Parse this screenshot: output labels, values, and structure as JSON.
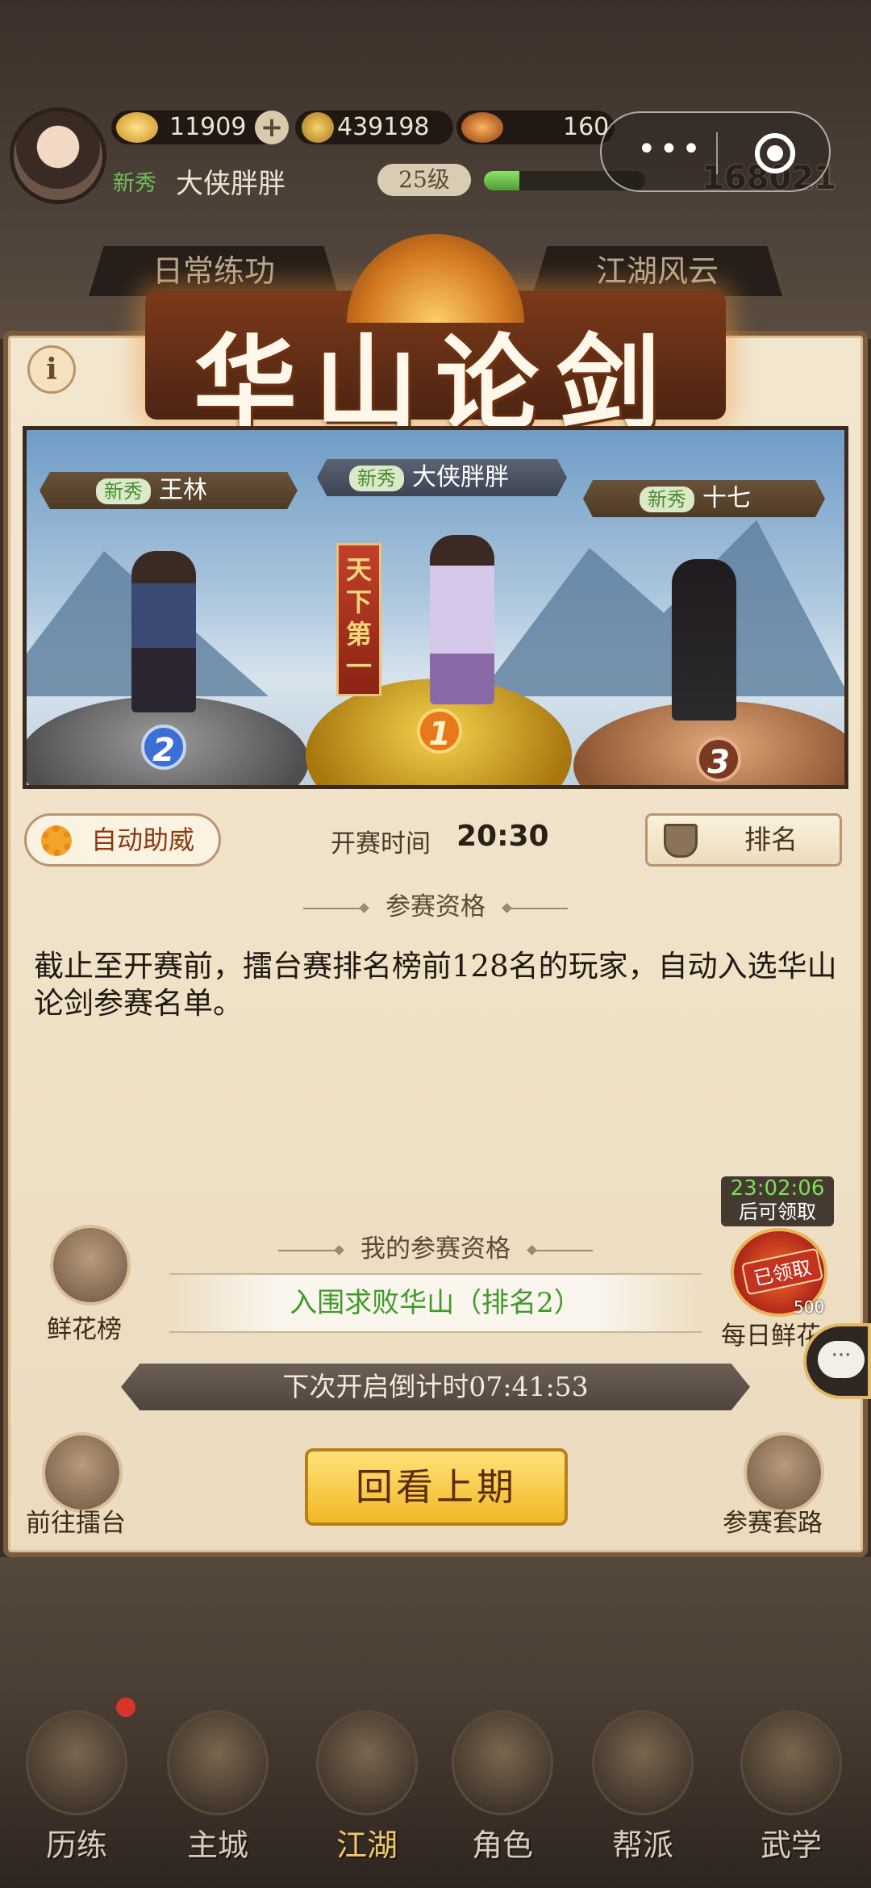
{
  "hud": {
    "gold_ingot": "11909",
    "coins": "439198",
    "stamina": "160",
    "newbie_tag": "新秀",
    "player_name": "大侠胖胖",
    "level": "25级",
    "exp_progress": 0.22,
    "power": "168021"
  },
  "bg_tabs": [
    "日常练功",
    "江湖风云"
  ],
  "panel": {
    "title": "华山论剑",
    "info_label": "i",
    "arena": {
      "banner_text": "天下第一",
      "contestants": [
        {
          "rank": "2",
          "tag": "新秀",
          "name": "王林"
        },
        {
          "rank": "1",
          "tag": "新秀",
          "name": "大侠胖胖"
        },
        {
          "rank": "3",
          "tag": "新秀",
          "name": "十七"
        }
      ]
    },
    "auto_cheer_label": "自动助威",
    "start_time_label": "开赛时间",
    "start_time": "20:30",
    "ranking_label": "排名",
    "qualification_heading": "参赛资格",
    "qualification_desc": "截止至开赛前，擂台赛排名榜前128名的玩家，自动入选华山论剑参赛名单。",
    "my_qualification_heading": "我的参赛资格",
    "my_qualification": "入围求败华山（排名2）",
    "countdown": "下次开启倒计时07:41:53",
    "replay_label": "回看上期",
    "flower_rank_label": "鲜花榜",
    "go_arena_label": "前往擂台",
    "strategy_label": "参赛套路",
    "daily": {
      "timer": "23:02:06",
      "timer_sub": "后可领取",
      "stamp": "已领取",
      "count": "500",
      "label": "每日鲜花"
    },
    "chat_glyph": "···"
  },
  "nav": [
    {
      "label": "历练",
      "icon": "training-icon"
    },
    {
      "label": "主城",
      "icon": "city-icon"
    },
    {
      "label": "江湖",
      "icon": "jianghu-icon"
    },
    {
      "label": "角色",
      "icon": "character-icon"
    },
    {
      "label": "帮派",
      "icon": "guild-icon"
    },
    {
      "label": "武学",
      "icon": "martial-arts-icon"
    }
  ],
  "miniprogram": {
    "more": "•••"
  }
}
